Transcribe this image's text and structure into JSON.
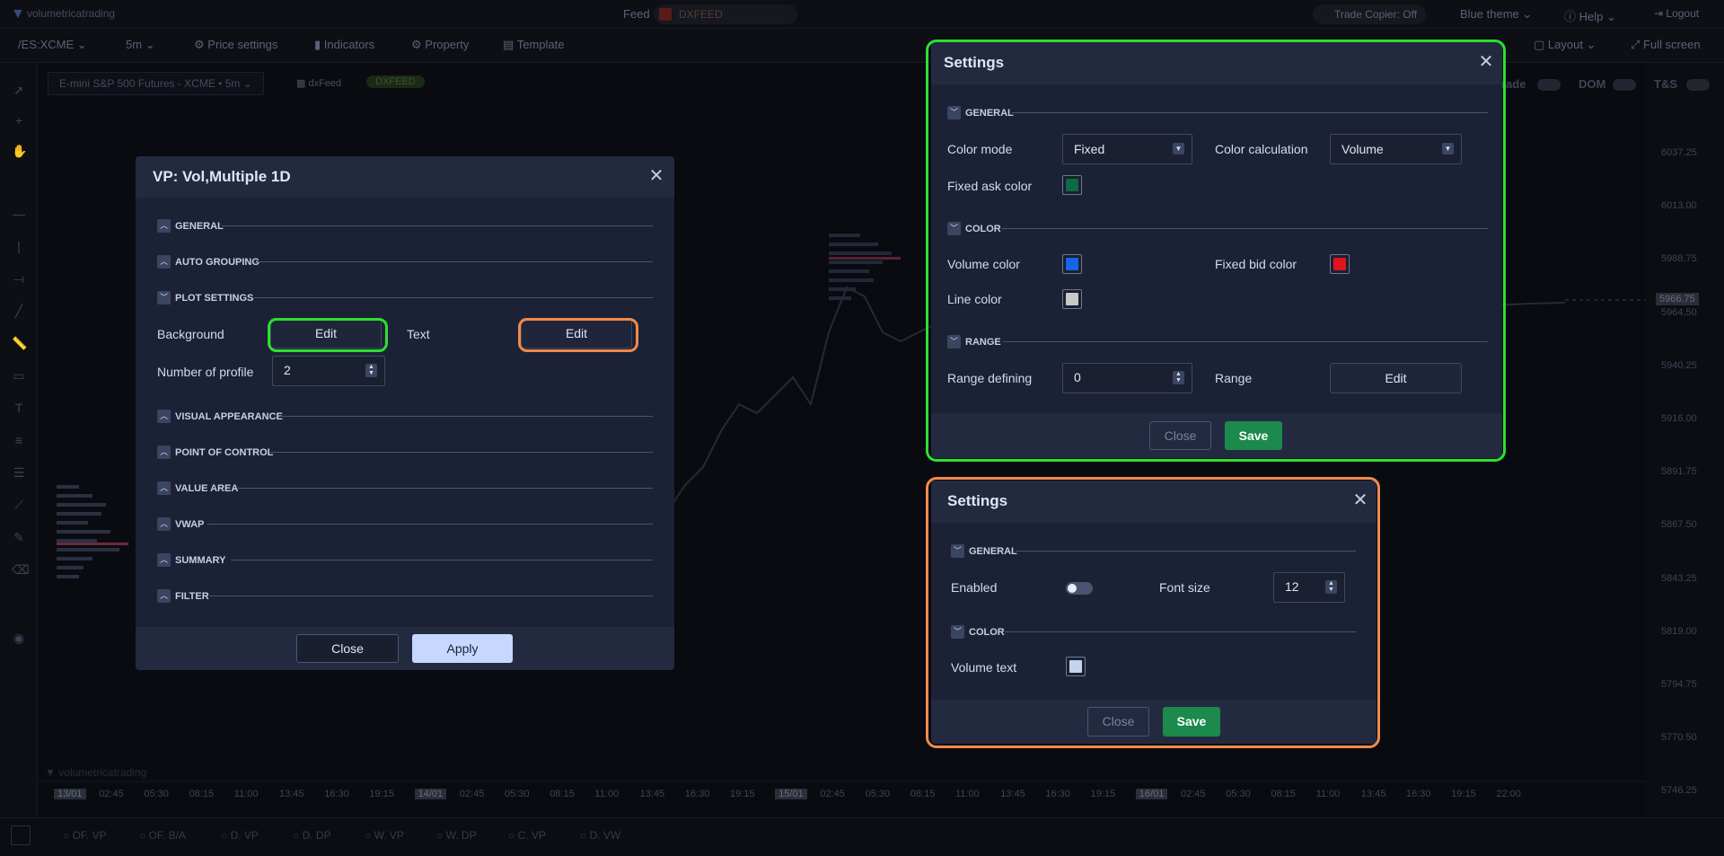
{
  "topbar": {
    "brand": "volumetricatrading",
    "feed_label": "Feed",
    "feed_name": "DXFEED",
    "trade_copier": "Trade Copier: Off",
    "theme": "Blue theme",
    "help": "Help",
    "logout": "Logout"
  },
  "toolbar": {
    "symbol": "/ES:XCME",
    "timeframe": "5m",
    "price_settings": "Price settings",
    "indicators": "Indicators",
    "property": "Property",
    "template": "Template",
    "layout": "Layout",
    "fullscreen": "Full screen"
  },
  "chart": {
    "header_title": "E-mini S&P 500 Futures - XCME • 5m",
    "provider": "dxFeed",
    "provider_badge": "DXFEED",
    "right_toggles": [
      "rade",
      "DOM",
      "T&S"
    ],
    "watermark": "volumetricatrading",
    "prices": [
      "6037.25",
      "6013.00",
      "5988.75",
      "5964.50",
      "5940.25",
      "5916.00",
      "5891.75",
      "5867.50",
      "5843.25",
      "5819.00",
      "5794.75",
      "5770.50",
      "5746.25"
    ],
    "current_price": "5966.75",
    "times": [
      "13/01",
      "02:45",
      "05:30",
      "08:15",
      "11:00",
      "13:45",
      "16:30",
      "19:15",
      "14/01",
      "02:45",
      "05:30",
      "08:15",
      "11:00",
      "13:45",
      "16:30",
      "19:15",
      "15/01",
      "02:45",
      "05:30",
      "08:15",
      "11:00",
      "13:45",
      "16:30",
      "19:15",
      "16/01",
      "02:45",
      "05:30",
      "08:15",
      "11:00",
      "13:45",
      "16:30",
      "19:15",
      "22:00"
    ]
  },
  "bottombar": {
    "items": [
      "OF. VP",
      "OF. B/A",
      "D. VP",
      "D. DP",
      "W. VP",
      "W. DP",
      "C. VP",
      "D. VW"
    ]
  },
  "vp_dialog": {
    "title": "VP: Vol,Multiple 1D",
    "sections": {
      "general": "GENERAL",
      "auto_grouping": "AUTO GROUPING",
      "plot_settings": "PLOT SETTINGS",
      "visual_appearance": "VISUAL APPEARANCE",
      "point_of_control": "POINT OF CONTROL",
      "value_area": "VALUE AREA",
      "vwap": "VWAP",
      "summary": "SUMMARY",
      "filter": "FILTER"
    },
    "background_label": "Background",
    "background_button": "Edit",
    "text_label": "Text",
    "text_button": "Edit",
    "profile_label": "Number of profile",
    "profile_value": "2",
    "close": "Close",
    "apply": "Apply"
  },
  "settings_bg": {
    "title": "Settings",
    "sections": {
      "general": "GENERAL",
      "color": "COLOR",
      "range": "RANGE"
    },
    "color_mode_label": "Color mode",
    "color_mode_value": "Fixed",
    "color_calc_label": "Color calculation",
    "color_calc_value": "Volume",
    "fixed_ask_label": "Fixed ask color",
    "fixed_ask_color": "#0c6b45",
    "volume_color_label": "Volume color",
    "volume_color": "#1565e8",
    "fixed_bid_label": "Fixed bid color",
    "fixed_bid_color": "#e0141e",
    "line_color_label": "Line color",
    "line_color": "#c9c9c9",
    "range_defining_label": "Range defining",
    "range_defining_value": "0",
    "range_label": "Range",
    "range_button": "Edit",
    "close": "Close",
    "save": "Save"
  },
  "settings_text": {
    "title": "Settings",
    "sections": {
      "general": "GENERAL",
      "color": "COLOR"
    },
    "enabled_label": "Enabled",
    "enabled": false,
    "font_size_label": "Font size",
    "font_size_value": "12",
    "volume_text_label": "Volume text",
    "volume_text_color": "#c6d3ee",
    "close": "Close",
    "save": "Save"
  },
  "colors": {
    "highlight_green": "#2ce02f",
    "highlight_orange": "#f08a4b",
    "save_green": "#1b8a4c"
  }
}
